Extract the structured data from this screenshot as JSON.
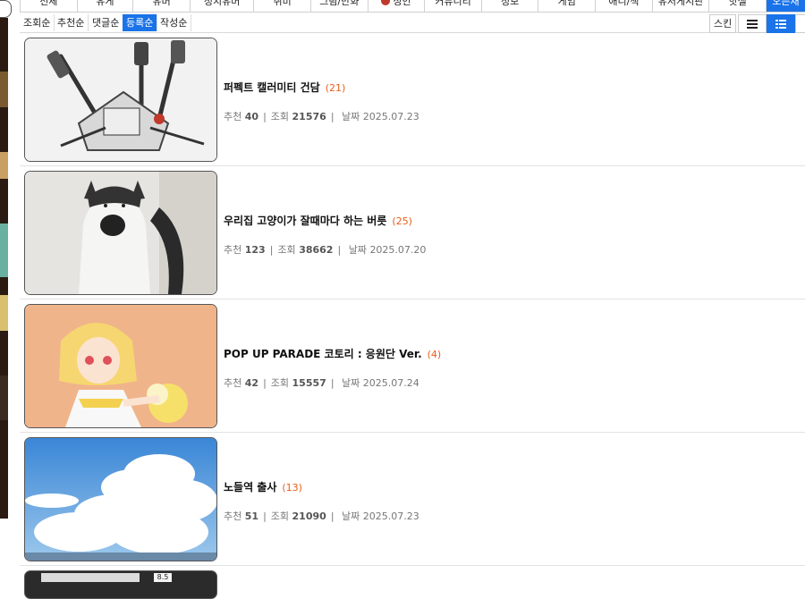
{
  "categories": [
    {
      "label": "",
      "active": false,
      "badge": false
    },
    {
      "label": "전체",
      "active": false,
      "badge": false
    },
    {
      "label": "유게",
      "active": false,
      "badge": false
    },
    {
      "label": "유머",
      "active": false,
      "badge": false
    },
    {
      "label": "정치유머",
      "active": false,
      "badge": false
    },
    {
      "label": "취미",
      "active": false,
      "badge": false
    },
    {
      "label": "그림/만화",
      "active": false,
      "badge": false
    },
    {
      "label": "성인",
      "active": false,
      "badge": true
    },
    {
      "label": "커뮤니티",
      "active": false,
      "badge": false
    },
    {
      "label": "정보",
      "active": false,
      "badge": false
    },
    {
      "label": "게임",
      "active": false,
      "badge": false
    },
    {
      "label": "애니/책",
      "active": false,
      "badge": false
    },
    {
      "label": "유저게시판",
      "active": false,
      "badge": false
    },
    {
      "label": "핫셀",
      "active": false,
      "badge": false
    },
    {
      "label": "오픈채",
      "active": true,
      "badge": false
    }
  ],
  "sort": {
    "buttons": [
      "조회순",
      "추천순",
      "댓글순",
      "등록순",
      "작성순"
    ],
    "active_index": 3,
    "skin_label": "스킨"
  },
  "posts": [
    {
      "title": "퍼펙트 캘러미티 건담",
      "comments": "(21)",
      "rec_label": "추천",
      "rec": "40",
      "views_label": "조회",
      "views": "21576",
      "date_label": "날짜",
      "date": "2025.07.23",
      "thumb": "mecha"
    },
    {
      "title": "우리집 고양이가 잘때마다 하는 버릇",
      "comments": "(25)",
      "rec_label": "추천",
      "rec": "123",
      "views_label": "조회",
      "views": "38662",
      "date_label": "날짜",
      "date": "2025.07.20",
      "thumb": "cat"
    },
    {
      "title": "POP UP PARADE 코토리 : 응원단 Ver.",
      "comments": "(4)",
      "rec_label": "추천",
      "rec": "42",
      "views_label": "조회",
      "views": "15557",
      "date_label": "날짜",
      "date": "2025.07.24",
      "thumb": "figure"
    },
    {
      "title": "노들역 출사",
      "comments": "(13)",
      "rec_label": "추천",
      "rec": "51",
      "views_label": "조회",
      "views": "21090",
      "date_label": "날짜",
      "date": "2025.07.23",
      "thumb": "sky"
    }
  ],
  "partial_thumb_text": "8.5",
  "colors": {
    "accent": "#1a73e8",
    "comment_count": "#e8601c"
  }
}
